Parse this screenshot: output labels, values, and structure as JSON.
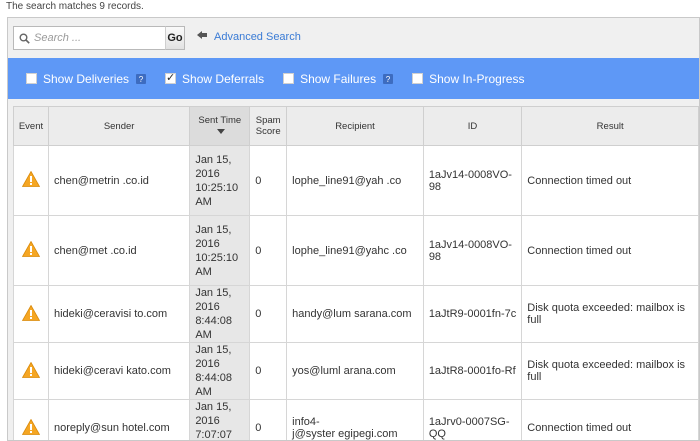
{
  "summary": "The search matches 9 records.",
  "search": {
    "placeholder": "Search ...",
    "value": "",
    "go_label": "Go",
    "advanced_label": "Advanced Search"
  },
  "filters": [
    {
      "label": "Show Deliveries",
      "checked": false,
      "has_info": true
    },
    {
      "label": "Show Deferrals",
      "checked": true,
      "has_info": false
    },
    {
      "label": "Show Failures",
      "checked": false,
      "has_info": true
    },
    {
      "label": "Show In-Progress",
      "checked": false,
      "has_info": false
    }
  ],
  "columns": [
    "Event",
    "Sender",
    "Sent Time",
    "Spam Score",
    "Recipient",
    "ID",
    "Result"
  ],
  "rows": [
    {
      "event_icon": "warning-icon",
      "sender": "chen@metrin   .co.id",
      "sent": [
        "Jan 15,",
        "2016",
        "10:25:10",
        "AM"
      ],
      "spam": "0",
      "recipient": "lophe_line91@yah  .co",
      "id": "1aJv14-0008VO-98",
      "result": "Connection timed out"
    },
    {
      "event_icon": "warning-icon",
      "sender": "chen@met      .co.id",
      "sent": [
        "Jan 15,",
        "2016",
        "10:25:10",
        "AM"
      ],
      "spam": "0",
      "recipient": "lophe_line91@yahc  .co",
      "id": "1aJv14-0008VO-98",
      "result": "Connection timed out"
    },
    {
      "event_icon": "warning-icon",
      "sender": "hideki@ceravisi    to.com",
      "sent": [
        "Jan 15,",
        "2016",
        "8:44:08 AM"
      ],
      "spam": "0",
      "recipient": "handy@lum    sarana.com",
      "id": "1aJtR9-0001fn-7c",
      "result": "Disk quota exceeded: mailbox is full"
    },
    {
      "event_icon": "warning-icon",
      "sender": "hideki@ceravi    kato.com",
      "sent": [
        "Jan 15,",
        "2016",
        "8:44:08 AM"
      ],
      "spam": "0",
      "recipient": "yos@luml    arana.com",
      "id": "1aJtR8-0001fo-Rf",
      "result": "Disk quota exceeded: mailbox is full"
    },
    {
      "event_icon": "warning-icon",
      "sender": "noreply@sun    hotel.com",
      "sent": [
        "Jan 15,",
        "2016",
        "7:07:07 AM"
      ],
      "spam": "0",
      "recipient": "info4-\nj@syster    egipegi.com",
      "id": "1aJrv0-0007SG-QQ",
      "result": "Connection timed out"
    }
  ],
  "colors": {
    "filter_bar": "#5e98f6",
    "link": "#3a7bd5",
    "warning": "#f5a623"
  }
}
